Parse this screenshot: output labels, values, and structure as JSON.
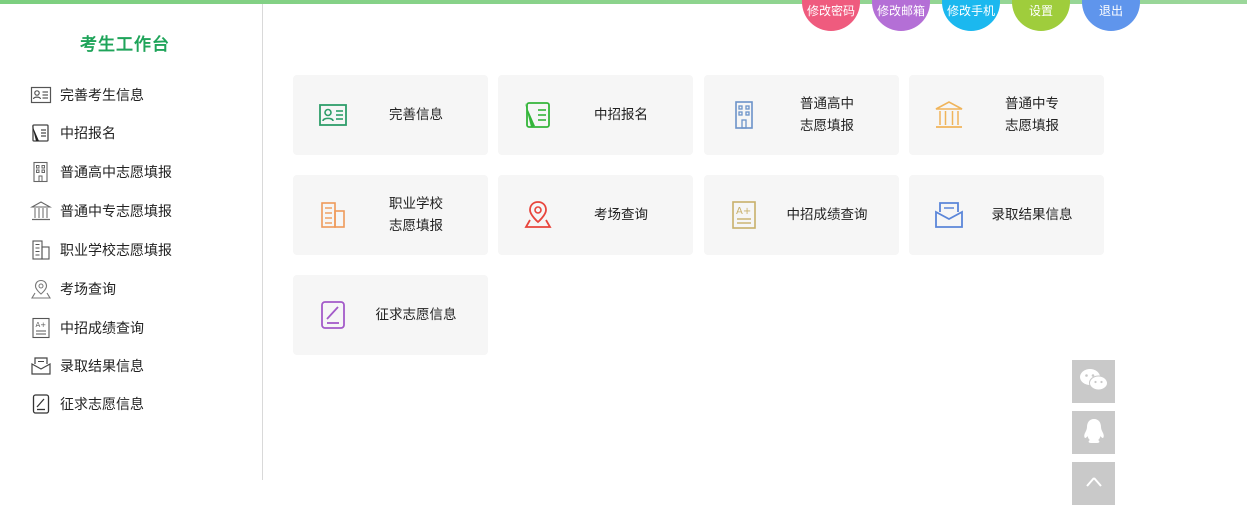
{
  "sidebar": {
    "title": "考生工作台",
    "items": [
      {
        "label": "完善考生信息"
      },
      {
        "label": "中招报名"
      },
      {
        "label": "普通高中志愿填报"
      },
      {
        "label": "普通中专志愿填报"
      },
      {
        "label": "职业学校志愿填报"
      },
      {
        "label": "考场查询"
      },
      {
        "label": "中招成绩查询"
      },
      {
        "label": "录取结果信息"
      },
      {
        "label": "征求志愿信息"
      }
    ]
  },
  "top_buttons": [
    {
      "label": "修改密码",
      "color": "#ef5b7e"
    },
    {
      "label": "修改邮箱",
      "color": "#b46fd6"
    },
    {
      "label": "修改手机",
      "color": "#1bb8ef"
    },
    {
      "label": "设置",
      "color": "#9fcd3c"
    },
    {
      "label": "退出",
      "color": "#5f95ec"
    }
  ],
  "cards": [
    {
      "line1": "完善信息",
      "line2": "",
      "icon": "id-card-icon",
      "color": "#2e9e6a"
    },
    {
      "line1": "中招报名",
      "line2": "",
      "icon": "register-pen-icon",
      "color": "#34b53a"
    },
    {
      "line1": "普通高中",
      "line2": "志愿填报",
      "icon": "high-school-building-icon",
      "color": "#6c93c9"
    },
    {
      "line1": "普通中专",
      "line2": "志愿填报",
      "icon": "institution-pillars-icon",
      "color": "#f0b45a"
    },
    {
      "line1": "职业学校",
      "line2": "志愿填报",
      "icon": "vocational-building-icon",
      "color": "#ef9a5a"
    },
    {
      "line1": "考场查询",
      "line2": "",
      "icon": "location-pin-icon",
      "color": "#e8453c"
    },
    {
      "line1": "中招成绩查询",
      "line2": "",
      "icon": "score-report-icon",
      "color": "#c8b06a"
    },
    {
      "line1": "录取结果信息",
      "line2": "",
      "icon": "envelope-icon",
      "color": "#5b86d9"
    },
    {
      "line1": "征求志愿信息",
      "line2": "",
      "icon": "edit-document-icon",
      "color": "#a35ac9"
    }
  ],
  "float_buttons": [
    {
      "icon": "wechat-icon"
    },
    {
      "icon": "qq-icon"
    },
    {
      "icon": "back-to-top-icon"
    }
  ]
}
